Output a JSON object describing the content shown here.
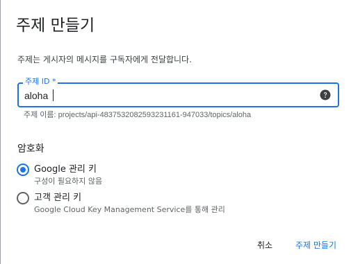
{
  "dialog": {
    "title": "주제 만들기",
    "description": "주제는 게시자의 메시지를 구독자에게 전달합니다."
  },
  "topic_id_field": {
    "label": "주제 ID *",
    "value": "aloha",
    "help_icon": "help-circle-icon",
    "hint": "주제 이름: projects/api-4837532082593231161-947033/topics/aloha"
  },
  "encryption": {
    "heading": "암호화",
    "options": [
      {
        "label": "Google 관리 키",
        "description": "구성이 필요하지 않음",
        "selected": true
      },
      {
        "label": "고객 관리 키",
        "description": "Google Cloud Key Management Service를 통해 관리",
        "selected": false
      }
    ]
  },
  "actions": {
    "cancel_label": "취소",
    "create_label": "주제 만들기"
  },
  "colors": {
    "accent": "#1a73e8",
    "text": "#202124",
    "secondary_text": "#5f6368"
  }
}
